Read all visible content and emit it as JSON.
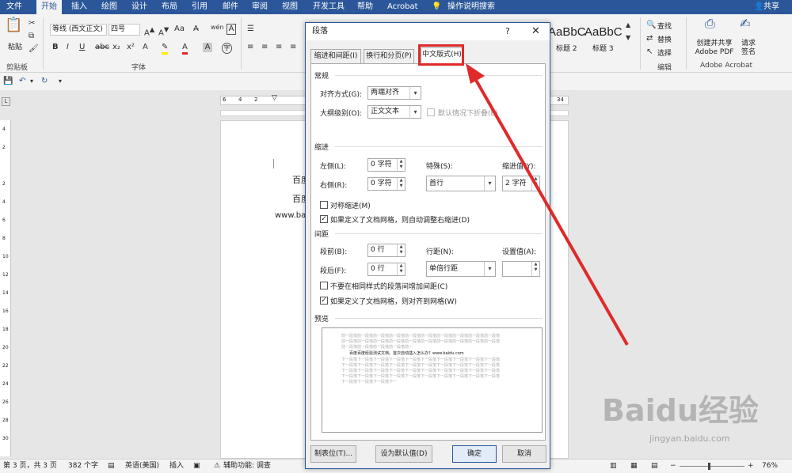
{
  "tabs": [
    "文件",
    "开始",
    "插入",
    "绘图",
    "设计",
    "布局",
    "引用",
    "邮件",
    "审阅",
    "视图",
    "开发工具",
    "帮助",
    "Acrobat",
    "操作说明搜索"
  ],
  "active_tab": "开始",
  "share": "共享",
  "ribbon": {
    "paste": "粘贴",
    "clipboard": "剪贴板",
    "font_name": "等线 (西文正文)",
    "font_size": "四号",
    "font_group": "字体",
    "styles": [
      "AaBbC",
      "AaBbC"
    ],
    "style_names": [
      "标题 2",
      "标题 3"
    ],
    "find": "查找",
    "replace": "替换",
    "select": "选择",
    "edit_group": "编辑",
    "create_pdf": "创建并共享 Adobe PDF",
    "request_sign": "请求 签名",
    "acrobat_group": "Adobe Acrobat"
  },
  "ruler": {
    "h_left": [
      "6",
      "4",
      "2"
    ],
    "h_right": [
      "34",
      "38"
    ],
    "v_ticks": [
      "4",
      "2",
      "",
      "2",
      "4",
      "6",
      "8",
      "10",
      "12",
      "14",
      "16",
      "18",
      "20",
      "22",
      "24",
      "26",
      "28",
      "30"
    ]
  },
  "document": {
    "line1": "百度",
    "line2": "百度",
    "line3": "www.baid"
  },
  "dialog": {
    "title": "段落",
    "help": "?",
    "close": "✕",
    "tabs": [
      "缩进和间距(I)",
      "换行和分页(P)",
      "中文版式(H)"
    ],
    "general": "常规",
    "alignment_label": "对齐方式(G):",
    "alignment_value": "两端对齐",
    "outline_label": "大纲级别(O):",
    "outline_value": "正文文本",
    "collapse_label": "默认情况下折叠(E)",
    "indent": "缩进",
    "left_label": "左侧(L):",
    "left_value": "0 字符",
    "right_label": "右侧(R):",
    "right_value": "0 字符",
    "special_label": "特殊(S):",
    "special_value": "首行",
    "indent_by_label": "缩进值(Y):",
    "indent_by_value": "2 字符",
    "mirror_label": "对称缩进(M)",
    "auto_indent_label": "如果定义了文档网格，则自动调整右缩进(D)",
    "spacing": "间距",
    "before_label": "段前(B):",
    "before_value": "0 行",
    "after_label": "段后(F):",
    "after_value": "0 行",
    "line_spacing_label": "行距(N):",
    "line_spacing_value": "单倍行距",
    "at_label": "设置值(A):",
    "no_space_label": "不要在相同样式的段落间增加间距(C)",
    "snap_grid_label": "如果定义了文档网格，则对齐到网格(W)",
    "preview": "预览",
    "preview_prev": "前一段落前一段落前一段落前一段落前一段落前一段落前一段落前一段落前一段落前一段落",
    "preview_body": "百度百度经验测试文档。首次自动插入怎么办？www.baidu.com",
    "preview_next": "下一段落下一段落下一段落下一段落下一段落下一段落下一段落下一段落下一段落下一段落",
    "buttons": [
      "制表位(T)...",
      "设为默认值(D)",
      "确定",
      "取消"
    ]
  },
  "status": {
    "page": "第 3 页，共 3 页",
    "words": "382 个字",
    "lang": "英语(美国)",
    "insert": "插入",
    "access": "辅助功能: 调查",
    "zoom": "76%"
  },
  "watermark": {
    "brand": "Baidu经验",
    "url": "jingyan.baidu.com"
  },
  "colors": {
    "accent": "#2b579a",
    "highlight": "#e02a2a"
  }
}
